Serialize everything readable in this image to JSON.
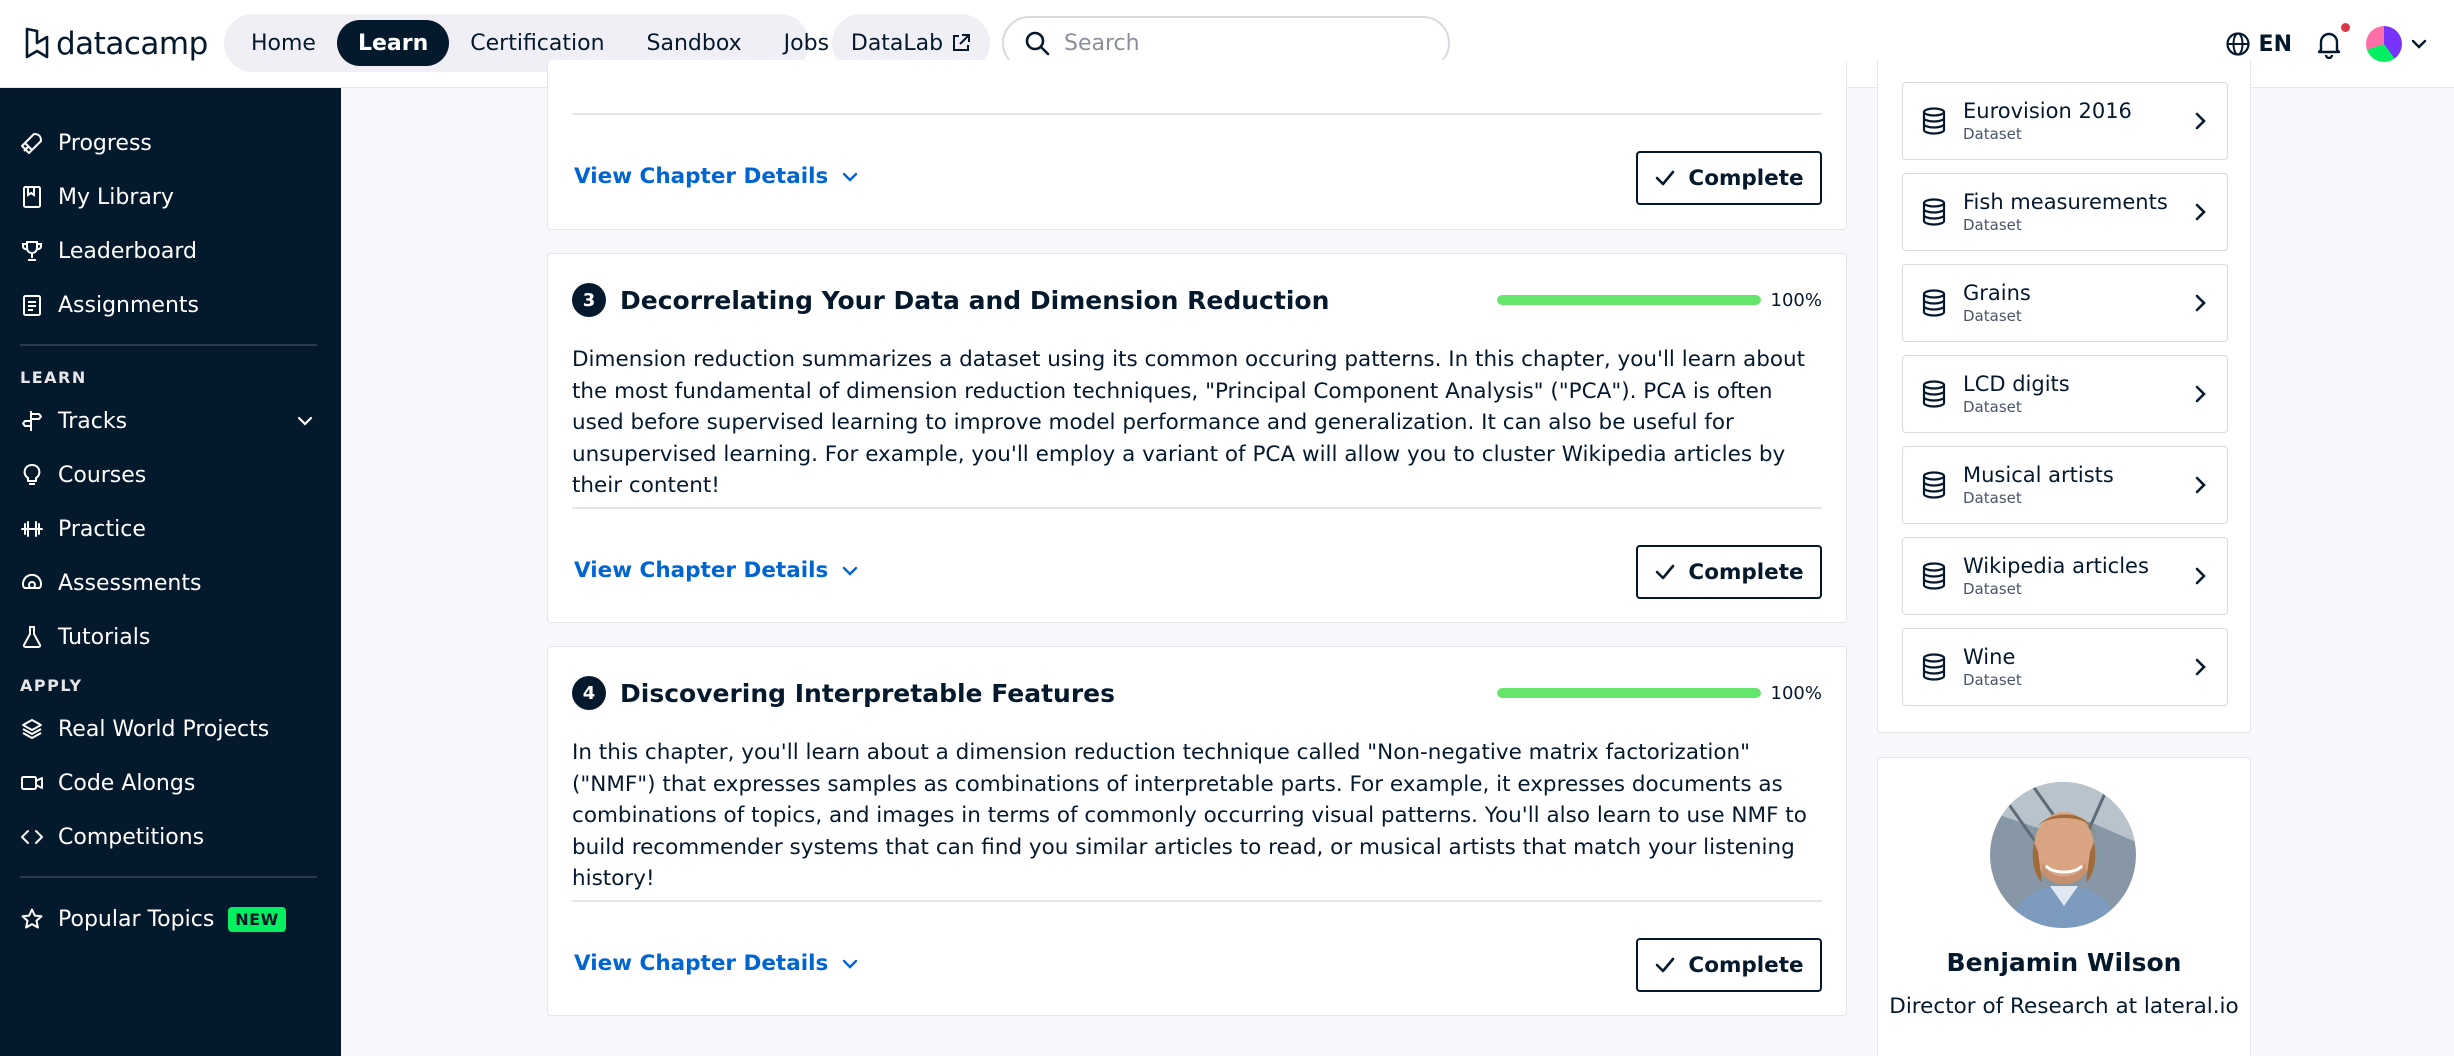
{
  "header": {
    "logo_text": "datacamp",
    "nav": [
      {
        "label": "Home",
        "active": false
      },
      {
        "label": "Learn",
        "active": true
      },
      {
        "label": "Certification",
        "active": false
      },
      {
        "label": "Sandbox",
        "active": false
      },
      {
        "label": "Jobs",
        "active": false
      }
    ],
    "datalab_label": "DataLab",
    "search_placeholder": "Search",
    "language": "EN"
  },
  "sidebar": {
    "top_items": [
      {
        "label": "Progress",
        "icon": "rocket-icon"
      },
      {
        "label": "My Library",
        "icon": "bookmark-book-icon"
      },
      {
        "label": "Leaderboard",
        "icon": "trophy-icon"
      },
      {
        "label": "Assignments",
        "icon": "assignment-icon"
      }
    ],
    "learn_heading": "LEARN",
    "learn_items": [
      {
        "label": "Tracks",
        "icon": "signpost-icon"
      },
      {
        "label": "Courses",
        "icon": "lightbulb-icon"
      },
      {
        "label": "Practice",
        "icon": "dumbbell-icon"
      },
      {
        "label": "Assessments",
        "icon": "gauge-icon"
      },
      {
        "label": "Tutorials",
        "icon": "flask-icon"
      }
    ],
    "apply_heading": "APPLY",
    "apply_items": [
      {
        "label": "Real World Projects",
        "icon": "layers-icon"
      },
      {
        "label": "Code Alongs",
        "icon": "video-icon"
      },
      {
        "label": "Competitions",
        "icon": "code-icon"
      }
    ],
    "popular_topics_label": "Popular Topics",
    "new_badge": "NEW"
  },
  "chapters": [
    {
      "view_details_label": "View Chapter Details",
      "complete_label": "Complete"
    },
    {
      "number": "3",
      "title": "Decorrelating Your Data and Dimension Reduction",
      "progress": 100,
      "progress_text": "100%",
      "description": "Dimension reduction summarizes a dataset using its common occuring patterns. In this chapter, you'll learn about the most fundamental of dimension reduction techniques, \"Principal Component Analysis\" (\"PCA\"). PCA is often used before supervised learning to improve model performance and generalization. It can also be useful for unsupervised learning. For example, you'll employ a variant of PCA will allow you to cluster Wikipedia articles by their content!",
      "view_details_label": "View Chapter Details",
      "complete_label": "Complete"
    },
    {
      "number": "4",
      "title": "Discovering Interpretable Features",
      "progress": 100,
      "progress_text": "100%",
      "description": "In this chapter, you'll learn about a dimension reduction technique called \"Non-negative matrix factorization\" (\"NMF\") that expresses samples as combinations of interpretable parts. For example, it expresses documents as combinations of topics, and images in terms of commonly occurring visual patterns. You'll also learn to use NMF to build recommender systems that can find you similar articles to read, or musical artists that match your listening history!",
      "view_details_label": "View Chapter Details",
      "complete_label": "Complete"
    }
  ],
  "datasets": [
    {
      "name": "Eurovision 2016",
      "type": "Dataset"
    },
    {
      "name": "Fish measurements",
      "type": "Dataset"
    },
    {
      "name": "Grains",
      "type": "Dataset"
    },
    {
      "name": "LCD digits",
      "type": "Dataset"
    },
    {
      "name": "Musical artists",
      "type": "Dataset"
    },
    {
      "name": "Wikipedia articles",
      "type": "Dataset"
    },
    {
      "name": "Wine",
      "type": "Dataset"
    }
  ],
  "author": {
    "name": "Benjamin Wilson",
    "role": "Director of Research at lateral.io"
  },
  "colors": {
    "navy": "#05192d",
    "link_blue": "#0065d1",
    "progress_green": "#65e56b",
    "new_badge_green": "#03ef62"
  }
}
